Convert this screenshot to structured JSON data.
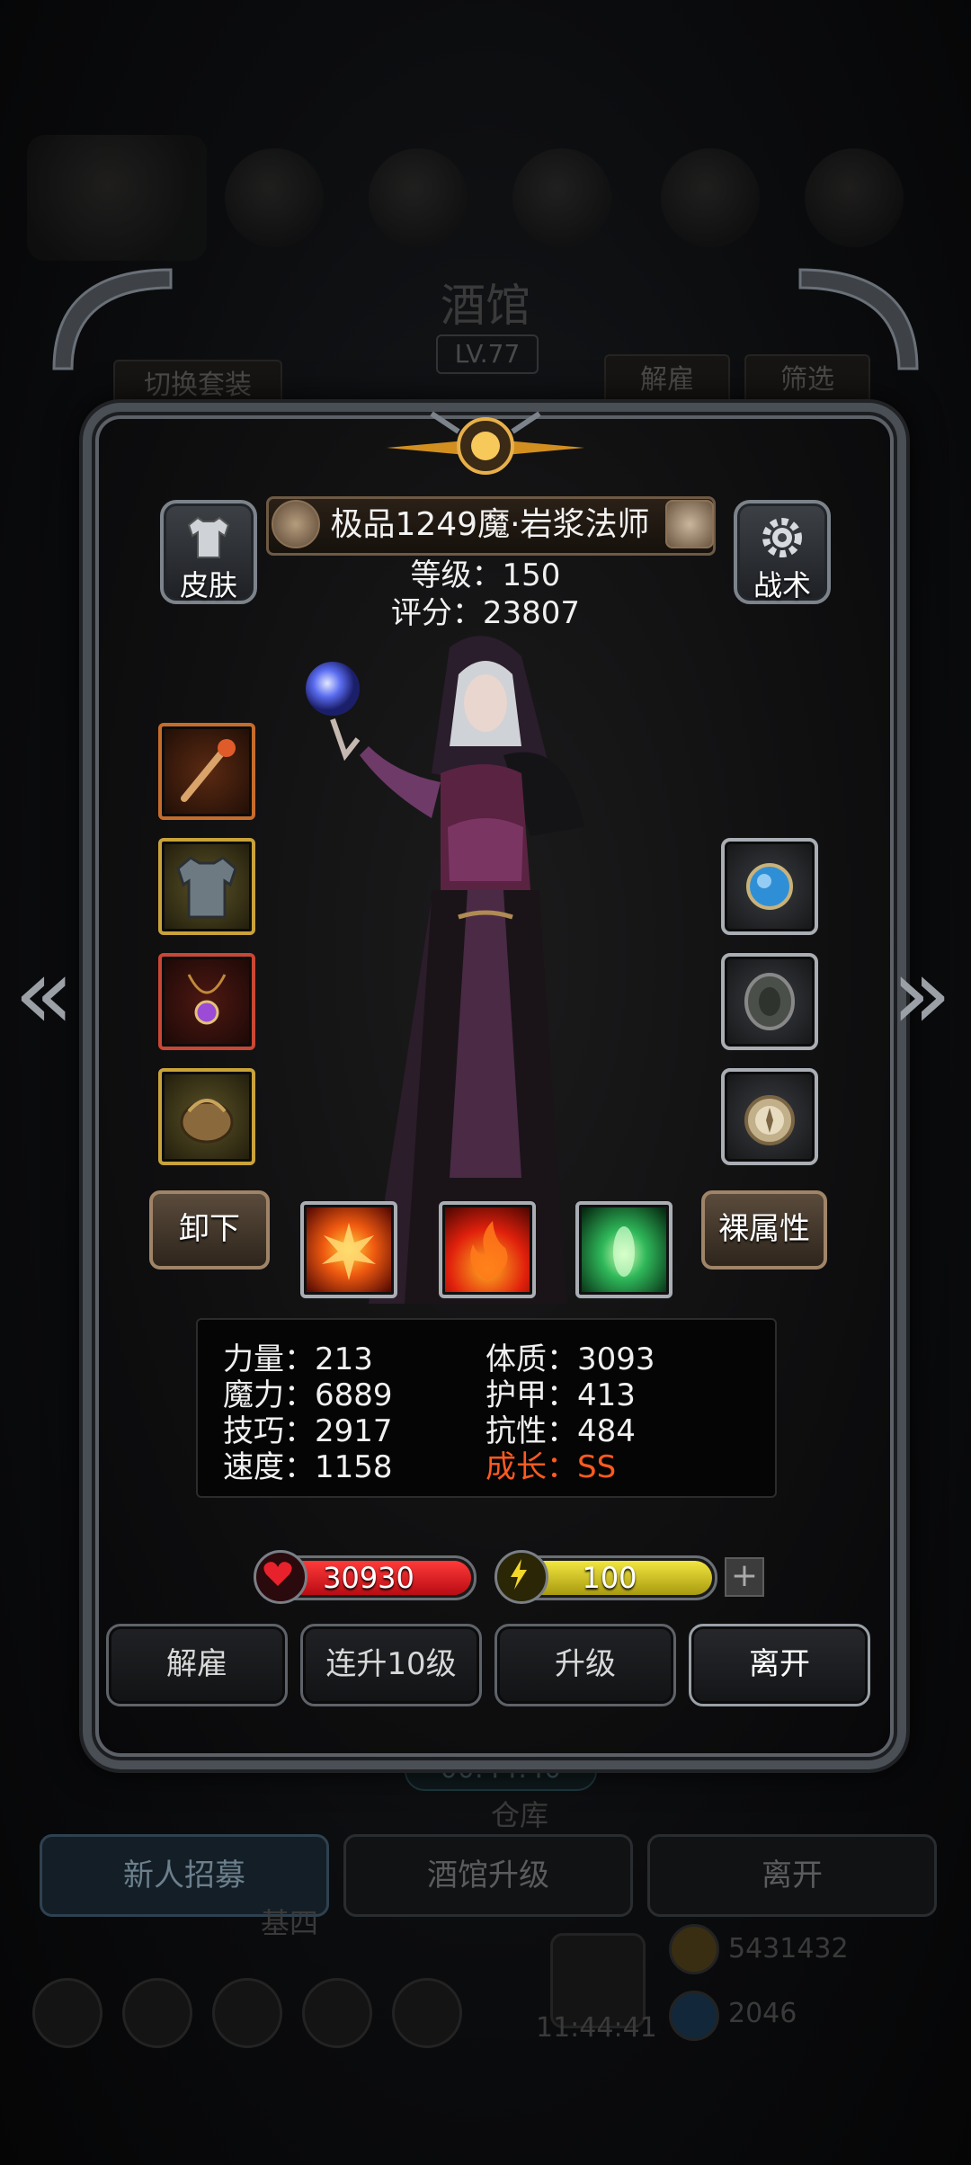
{
  "background": {
    "title": "酒馆",
    "level": "LV.77",
    "switch_outfit": "切换套装",
    "dismiss": "解雇",
    "filter": "筛选",
    "timer": "00:44:40",
    "warehouse": "仓库",
    "bottom_buttons": [
      "新人招募",
      "酒馆升级",
      "离开"
    ],
    "estate": "基四",
    "clock": "11:44:41",
    "gold": "5431432",
    "gems": "2046"
  },
  "hero": {
    "name": "极品1249魔·岩浆法师",
    "level_label": "等级：150",
    "score_label": "评分：23807"
  },
  "buttons": {
    "skin": "皮肤",
    "tactics": "战术",
    "unequip": "卸下",
    "base_attributes": "裸属性"
  },
  "equipment": {
    "left": [
      "staff-icon",
      "robe-icon",
      "amulet-icon",
      "bag-icon"
    ],
    "right": [
      "orb-icon",
      "shield-icon",
      "compass-icon"
    ]
  },
  "skills": [
    "explosion-skill-icon",
    "fire-skill-icon",
    "heal-skill-icon"
  ],
  "attributes": {
    "strength": "力量：213",
    "magic": "魔力：6889",
    "skill": "技巧：2917",
    "speed": "速度：1158",
    "constitution": "体质：3093",
    "armor": "护甲：413",
    "resistance": "抗性：484",
    "growth": "成长：SS"
  },
  "resources": {
    "health": "30930",
    "energy": "100"
  },
  "actions": {
    "dismiss": "解雇",
    "level_up_10": "连升10级",
    "level_up": "升级",
    "leave": "离开"
  },
  "colors": {
    "growth": "#ff5a1f",
    "health_bar": "#c4121a",
    "energy_bar": "#d2c21a"
  }
}
